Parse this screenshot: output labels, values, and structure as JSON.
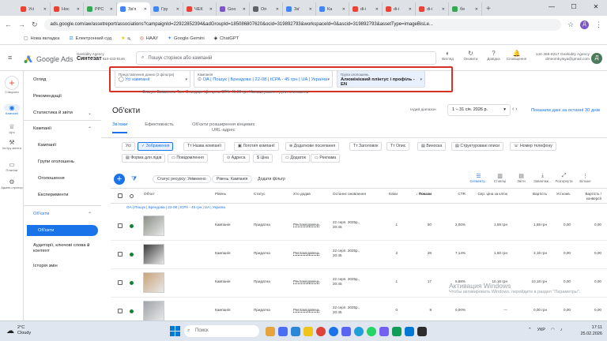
{
  "browser": {
    "tabs": [
      {
        "label": "Усі",
        "color": "#ea4335"
      },
      {
        "label": "Ноc",
        "color": "#ea4335"
      },
      {
        "label": "PPC",
        "color": "#34a853"
      },
      {
        "label": "Зв'я",
        "color": "#4285f4",
        "active": true
      },
      {
        "label": "Гру",
        "color": "#4285f4"
      },
      {
        "label": "ЧЕК",
        "color": "#ea4335"
      },
      {
        "label": "Goo",
        "color": "#7e57c2"
      },
      {
        "label": "Оп",
        "color": "#5f6368"
      },
      {
        "label": "Зв'",
        "color": "#4285f4"
      },
      {
        "label": "Ка",
        "color": "#4285f4"
      },
      {
        "label": "di-i",
        "color": "#ea4335"
      },
      {
        "label": "di-i",
        "color": "#ea4335"
      },
      {
        "label": "di-i",
        "color": "#ea4335"
      },
      {
        "label": "бе",
        "color": "#34a853"
      }
    ],
    "new_tab": "+",
    "url": "ads.google.com/aw/assetreport/associations?campaignId=22922852394&adGroupId=185086807620&ocid=319892793&workspaceId=0&ascid=319892793&assetType=imageBisLe...",
    "bookmarks": [
      "Нова вкладка",
      "Електронний суд",
      "ц",
      "НААУ",
      "Google Gemini",
      "ChatGPT"
    ]
  },
  "ads_header": {
    "product": "Google Ads",
    "account_line": "Geekidity Agency",
    "account_name": "Синтезат",
    "account_id": "810-433-9146",
    "search_placeholder": "Пошук сторінок або кампаній",
    "tools": [
      "Вигляд",
      "Оновити",
      "Довідка",
      "Сповіщення"
    ],
    "user_id": "144-469-8217 Geekidity Agency",
    "user_email": "dmeomkyisya@gmail.com",
    "avatar_letter": "Д"
  },
  "rail": [
    "Створити",
    "Кампанії",
    "Цілі",
    "Інстру-менти",
    "Платежі",
    "Адміні-стратор"
  ],
  "nav": {
    "items": [
      "Огляд",
      "Рекомендації",
      "Статистика й звіти",
      "Кампанії",
      "Кампанії",
      "Групи оголошень",
      "Оголошення",
      "Експерименти",
      "Об'єкти",
      "Об'єкти",
      "Аудиторії, ключові слова й контент",
      "Історія змін"
    ]
  },
  "filters": {
    "view_label": "Представлення даних (2 фільтри)",
    "view_value": "Усі кампанії",
    "campaign_label": "Кампанія",
    "campaign_value": "OA | Пошук | Брендова | 22-08 | tCPA - 45 грн | UA | Україна",
    "adgroup_label": "Група оголошень",
    "adgroup_value": "Алюмінієвий плінтус і профіль - EN",
    "status_line": "Статус: Ввімкнено    Тип: Стандарт    Ціл.цена CPA: 45,00 грн    Налаштування групи оголошень"
  },
  "page": {
    "title": "Об'єкти",
    "date_caption": "Індий діапазон",
    "date_value": "1 – 31 січ. 2026 р.",
    "show_last": "Показати дані за останні 30 днів",
    "tabs": [
      "Зв'язки",
      "Ефективність",
      "Об'єкти розширення кінцевих URL-адрес"
    ]
  },
  "asset_types": [
    "Усі",
    "Зображення",
    "Назва компанії",
    "Логотип компанії",
    "Додаткове посилання",
    "Заголовок",
    "Опис",
    "Виноска",
    "Структуровані описи",
    "Номер телефону",
    "Форма для лідів",
    "Повідомлення",
    "Адреса",
    "Ціна",
    "Додаток",
    "Реклама"
  ],
  "table_controls": {
    "filter_chips": [
      "Статус ресурсу: Увімкнено",
      "Рівень: Кампанія"
    ],
    "add_filter": "Додати фільтр",
    "tools": [
      "Сегменту...",
      "Стовпці",
      "Звіти",
      "Завантаж...",
      "Розгорнути",
      "Більше"
    ]
  },
  "table": {
    "headers": [
      "Об'єкт",
      "Рівень",
      "Статус",
      "Хто додав",
      "Останнє оновлення",
      "Кліки",
      "↓ Покази",
      "CTR",
      "Сер. ціна за кл/ок",
      "Вартість",
      "Усі конв.",
      "Вартість / конверсії"
    ],
    "group_row": "OA | Пошук | Брендова | 22-08 | tCPA - 45 грн | UA | Україна",
    "rows": [
      {
        "level": "Кампанія",
        "status": "Придатна",
        "added": "Рекламодавець",
        "updated": "22 серп. 2025р., 20:45",
        "clicks": "1",
        "impr": "50",
        "ctr": "2,00%",
        "cpc": "1,59 грн",
        "cost": "1,59 грн",
        "conv": "0,00",
        "cpconv": "0,00",
        "thumb_color": "#8a8f86"
      },
      {
        "level": "Кампанія",
        "status": "Придатна",
        "added": "Рекламодавець",
        "updated": "22 серп. 2025р., 20:45",
        "clicks": "2",
        "impr": "28",
        "ctr": "7,14%",
        "cpc": "1,60 грн",
        "cost": "3,19 грн",
        "conv": "0,00",
        "cpconv": "0,00",
        "thumb_color": "#3b3b3b"
      },
      {
        "level": "Кампанія",
        "status": "Придатна",
        "added": "Рекламодавець",
        "updated": "22 серп. 2025р., 20:45",
        "clicks": "1",
        "impr": "17",
        "ctr": "5,88%",
        "cpc": "10,18 грн",
        "cost": "10,18 грн",
        "conv": "0,00",
        "cpconv": "0,00",
        "thumb_color": "#c9a37b"
      },
      {
        "level": "Кампанія",
        "status": "Придатна",
        "added": "Рекламодавець",
        "updated": "22 серп. 2025р., 20:45",
        "clicks": "0",
        "impr": "8",
        "ctr": "0,00%",
        "cpc": "—",
        "cost": "0,00 грн",
        "conv": "0,00",
        "cpconv": "0,00",
        "thumb_color": "#9ea3a8"
      }
    ]
  },
  "watermark": {
    "title": "Активация Windows",
    "text": "Чтобы активировать Windows, перейдите в раздел \"Параметры\"."
  },
  "taskbar": {
    "temp": "2°C",
    "weather": "Cloudy",
    "search": "Поиск",
    "lang": "УКР",
    "time": "17:11",
    "date": "25.02.2026"
  }
}
